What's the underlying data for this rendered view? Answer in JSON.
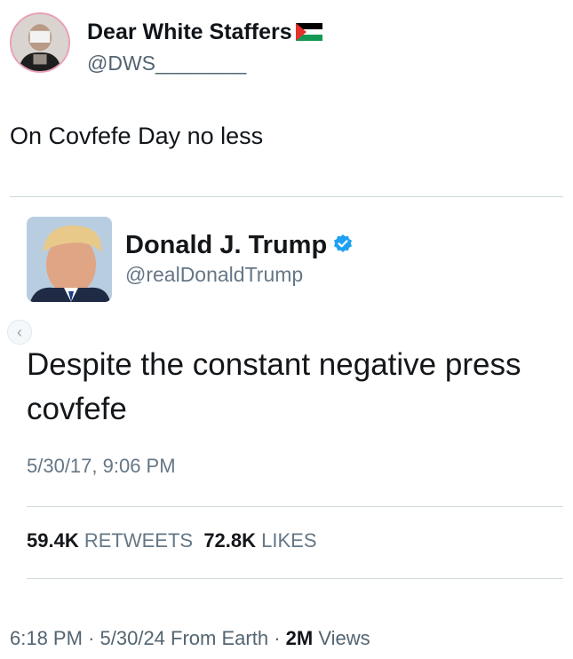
{
  "outer_tweet": {
    "display_name": "Dear White Staffers",
    "flag_icon": "palestine-flag-icon",
    "handle": "@DWS________",
    "text": "On Covfefe Day no less",
    "time": "6:18 PM",
    "date": "5/30/24",
    "source": "From Earth",
    "views_count": "2M",
    "views_label": "Views",
    "separator": "·"
  },
  "quoted_tweet": {
    "display_name": "Donald J. Trump",
    "verified_icon": "verified-badge-icon",
    "handle": "@realDonaldTrump",
    "text": "Despite the constant negative press covfefe",
    "timestamp": "5/30/17, 9:06 PM",
    "retweets_count": "59.4K",
    "retweets_label": "RETWEETS",
    "likes_count": "72.8K",
    "likes_label": "LIKES"
  },
  "colors": {
    "verified_blue": "#1da1f2",
    "secondary_text": "#657786",
    "divider": "#cfd9de"
  }
}
